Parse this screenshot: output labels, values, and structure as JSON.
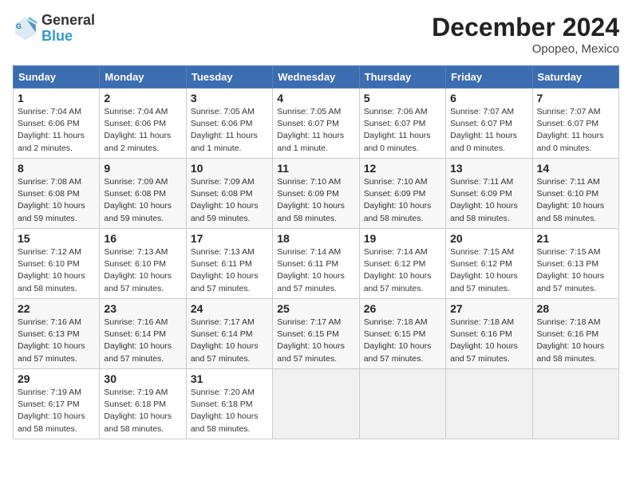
{
  "header": {
    "logo_line1": "General",
    "logo_line2": "Blue",
    "month": "December 2024",
    "location": "Opopeo, Mexico"
  },
  "days_of_week": [
    "Sunday",
    "Monday",
    "Tuesday",
    "Wednesday",
    "Thursday",
    "Friday",
    "Saturday"
  ],
  "weeks": [
    [
      {
        "day": 1,
        "info": "Sunrise: 7:04 AM\nSunset: 6:06 PM\nDaylight: 11 hours\nand 2 minutes."
      },
      {
        "day": 2,
        "info": "Sunrise: 7:04 AM\nSunset: 6:06 PM\nDaylight: 11 hours\nand 2 minutes."
      },
      {
        "day": 3,
        "info": "Sunrise: 7:05 AM\nSunset: 6:06 PM\nDaylight: 11 hours\nand 1 minute."
      },
      {
        "day": 4,
        "info": "Sunrise: 7:05 AM\nSunset: 6:07 PM\nDaylight: 11 hours\nand 1 minute."
      },
      {
        "day": 5,
        "info": "Sunrise: 7:06 AM\nSunset: 6:07 PM\nDaylight: 11 hours\nand 0 minutes."
      },
      {
        "day": 6,
        "info": "Sunrise: 7:07 AM\nSunset: 6:07 PM\nDaylight: 11 hours\nand 0 minutes."
      },
      {
        "day": 7,
        "info": "Sunrise: 7:07 AM\nSunset: 6:07 PM\nDaylight: 11 hours\nand 0 minutes."
      }
    ],
    [
      {
        "day": 8,
        "info": "Sunrise: 7:08 AM\nSunset: 6:08 PM\nDaylight: 10 hours\nand 59 minutes."
      },
      {
        "day": 9,
        "info": "Sunrise: 7:09 AM\nSunset: 6:08 PM\nDaylight: 10 hours\nand 59 minutes."
      },
      {
        "day": 10,
        "info": "Sunrise: 7:09 AM\nSunset: 6:08 PM\nDaylight: 10 hours\nand 59 minutes."
      },
      {
        "day": 11,
        "info": "Sunrise: 7:10 AM\nSunset: 6:09 PM\nDaylight: 10 hours\nand 58 minutes."
      },
      {
        "day": 12,
        "info": "Sunrise: 7:10 AM\nSunset: 6:09 PM\nDaylight: 10 hours\nand 58 minutes."
      },
      {
        "day": 13,
        "info": "Sunrise: 7:11 AM\nSunset: 6:09 PM\nDaylight: 10 hours\nand 58 minutes."
      },
      {
        "day": 14,
        "info": "Sunrise: 7:11 AM\nSunset: 6:10 PM\nDaylight: 10 hours\nand 58 minutes."
      }
    ],
    [
      {
        "day": 15,
        "info": "Sunrise: 7:12 AM\nSunset: 6:10 PM\nDaylight: 10 hours\nand 58 minutes."
      },
      {
        "day": 16,
        "info": "Sunrise: 7:13 AM\nSunset: 6:10 PM\nDaylight: 10 hours\nand 57 minutes."
      },
      {
        "day": 17,
        "info": "Sunrise: 7:13 AM\nSunset: 6:11 PM\nDaylight: 10 hours\nand 57 minutes."
      },
      {
        "day": 18,
        "info": "Sunrise: 7:14 AM\nSunset: 6:11 PM\nDaylight: 10 hours\nand 57 minutes."
      },
      {
        "day": 19,
        "info": "Sunrise: 7:14 AM\nSunset: 6:12 PM\nDaylight: 10 hours\nand 57 minutes."
      },
      {
        "day": 20,
        "info": "Sunrise: 7:15 AM\nSunset: 6:12 PM\nDaylight: 10 hours\nand 57 minutes."
      },
      {
        "day": 21,
        "info": "Sunrise: 7:15 AM\nSunset: 6:13 PM\nDaylight: 10 hours\nand 57 minutes."
      }
    ],
    [
      {
        "day": 22,
        "info": "Sunrise: 7:16 AM\nSunset: 6:13 PM\nDaylight: 10 hours\nand 57 minutes."
      },
      {
        "day": 23,
        "info": "Sunrise: 7:16 AM\nSunset: 6:14 PM\nDaylight: 10 hours\nand 57 minutes."
      },
      {
        "day": 24,
        "info": "Sunrise: 7:17 AM\nSunset: 6:14 PM\nDaylight: 10 hours\nand 57 minutes."
      },
      {
        "day": 25,
        "info": "Sunrise: 7:17 AM\nSunset: 6:15 PM\nDaylight: 10 hours\nand 57 minutes."
      },
      {
        "day": 26,
        "info": "Sunrise: 7:18 AM\nSunset: 6:15 PM\nDaylight: 10 hours\nand 57 minutes."
      },
      {
        "day": 27,
        "info": "Sunrise: 7:18 AM\nSunset: 6:16 PM\nDaylight: 10 hours\nand 57 minutes."
      },
      {
        "day": 28,
        "info": "Sunrise: 7:18 AM\nSunset: 6:16 PM\nDaylight: 10 hours\nand 58 minutes."
      }
    ],
    [
      {
        "day": 29,
        "info": "Sunrise: 7:19 AM\nSunset: 6:17 PM\nDaylight: 10 hours\nand 58 minutes."
      },
      {
        "day": 30,
        "info": "Sunrise: 7:19 AM\nSunset: 6:18 PM\nDaylight: 10 hours\nand 58 minutes."
      },
      {
        "day": 31,
        "info": "Sunrise: 7:20 AM\nSunset: 6:18 PM\nDaylight: 10 hours\nand 58 minutes."
      },
      null,
      null,
      null,
      null
    ]
  ]
}
